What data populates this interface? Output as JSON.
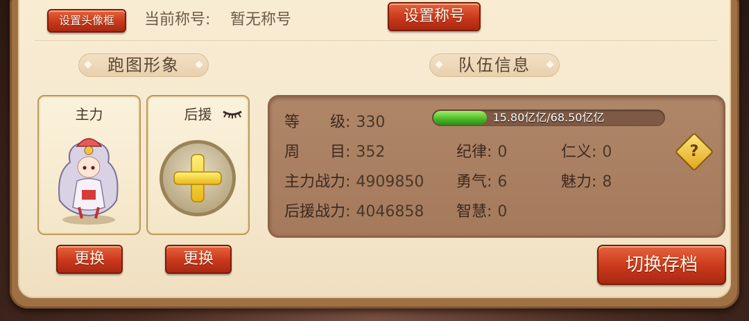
{
  "header": {
    "set_frame_label": "设置头像框",
    "current_title_label": "当前称号:",
    "current_title_value": "暂无称号",
    "set_title_label": "设置称号"
  },
  "sections": {
    "avatar_section_title": "跑图形象",
    "team_section_title": "队伍信息"
  },
  "cards": {
    "main_label": "主力",
    "support_label": "后援",
    "main_change_label": "更换",
    "support_change_label": "更换"
  },
  "team_info": {
    "level_key": "等　　级:",
    "level_value": "330",
    "exp_text": "15.80亿亿/68.50亿亿",
    "exp_current": 15.8,
    "exp_max": 68.5,
    "cycle_key": "周　　目:",
    "cycle_value": "352",
    "main_power_key": "主力战力:",
    "main_power_value": "4909850",
    "support_power_key": "后援战力:",
    "support_power_value": "4046858",
    "discipline_key": "纪律:",
    "discipline_value": "0",
    "courage_key": "勇气:",
    "courage_value": "6",
    "wisdom_key": "智慧:",
    "wisdom_value": "0",
    "benevolence_key": "仁义:",
    "benevolence_value": "0",
    "charm_key": "魅力:",
    "charm_value": "8"
  },
  "actions": {
    "switch_save_label": "切换存档"
  },
  "icons": {
    "help": "question-diamond-icon",
    "add": "plus-icon",
    "collapse": "eyelash-icon"
  },
  "colors": {
    "button_red": "#c9381b",
    "panel_bg": "#f5e7cc",
    "info_box_bg": "#a57a5c",
    "exp_green": "#49b726"
  }
}
